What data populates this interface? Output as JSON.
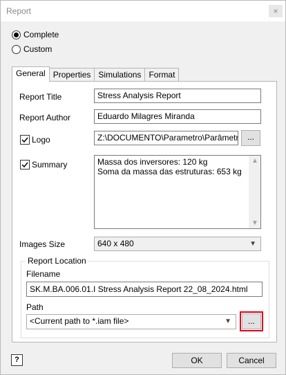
{
  "window": {
    "title": "Report",
    "close_glyph": "×"
  },
  "scope": {
    "complete_label": "Complete",
    "custom_label": "Custom",
    "selected": "complete"
  },
  "tabs": [
    {
      "label": "General",
      "active": true
    },
    {
      "label": "Properties",
      "active": false
    },
    {
      "label": "Simulations",
      "active": false
    },
    {
      "label": "Format",
      "active": false
    }
  ],
  "general": {
    "report_title_label": "Report Title",
    "report_title_value": "Stress Analysis Report",
    "report_author_label": "Report Author",
    "report_author_value": "Eduardo Milagres Miranda",
    "logo_label": "Logo",
    "logo_checked": true,
    "logo_path": "Z:\\DOCUMENTO\\Parametro\\Parâmetros\\Dados",
    "browse_label": "...",
    "summary_label": "Summary",
    "summary_checked": true,
    "summary_lines": [
      "Massa dos inversores: 120 kg",
      "Soma da massa das estruturas: 653 kg"
    ],
    "images_size_label": "Images Size",
    "images_size_value": "640 x 480",
    "report_location_label": "Report Location",
    "filename_label": "Filename",
    "filename_value": "SK.M.BA.006.01.I Stress Analysis Report 22_08_2024.html",
    "path_label": "Path",
    "path_value": "<Current path to *.iam file>",
    "path_browse_label": "..."
  },
  "footer": {
    "help_label": "?",
    "ok_label": "OK",
    "cancel_label": "Cancel"
  },
  "colors": {
    "highlight": "#e0001a"
  }
}
